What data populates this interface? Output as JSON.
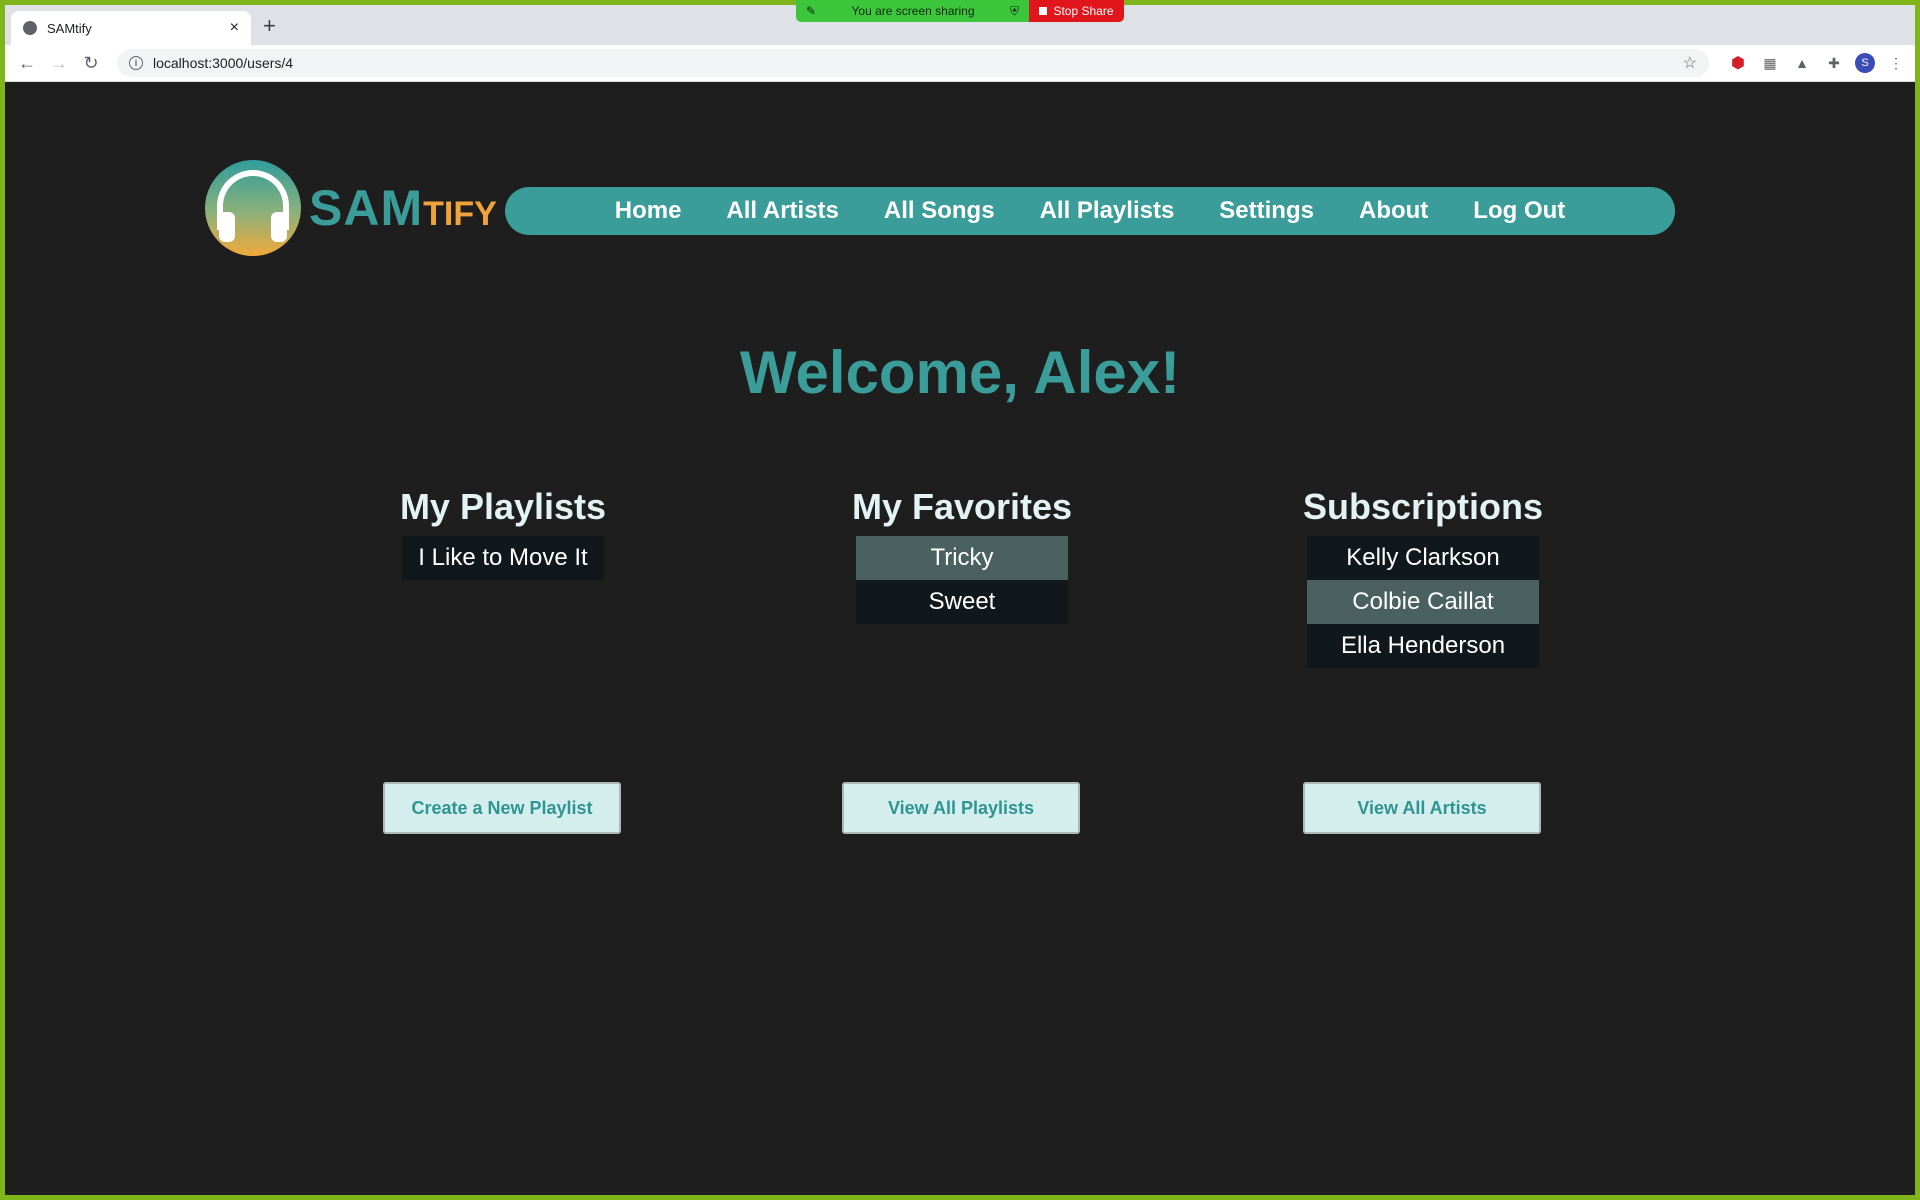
{
  "screen_share": {
    "message": "You are screen sharing",
    "stop_label": "Stop Share"
  },
  "browser": {
    "tab_title": "SAMtify",
    "url": "localhost:3000/users/4",
    "avatar_letter": "S"
  },
  "brand": {
    "sam": "SAM",
    "tify": "TIFY"
  },
  "nav": {
    "items": [
      {
        "label": "Home"
      },
      {
        "label": "All Artists"
      },
      {
        "label": "All Songs"
      },
      {
        "label": "All Playlists"
      },
      {
        "label": "Settings"
      },
      {
        "label": "About"
      },
      {
        "label": "Log Out"
      }
    ]
  },
  "welcome": "Welcome, Alex!",
  "sections": {
    "playlists": {
      "title": "My Playlists",
      "items": [
        {
          "label": "I Like to Move It"
        }
      ],
      "button": "Create a New Playlist"
    },
    "favorites": {
      "title": "My Favorites",
      "items": [
        {
          "label": "Tricky"
        },
        {
          "label": "Sweet"
        }
      ],
      "button": "View All Playlists"
    },
    "subscriptions": {
      "title": "Subscriptions",
      "items": [
        {
          "label": "Kelly Clarkson"
        },
        {
          "label": "Colbie Caillat"
        },
        {
          "label": "Ella Henderson"
        }
      ],
      "button": "View All Artists"
    }
  },
  "colors": {
    "accent": "#3a9d99",
    "orange": "#f0a33a",
    "background": "#1e1e1e",
    "highlight": "#4a615f"
  }
}
